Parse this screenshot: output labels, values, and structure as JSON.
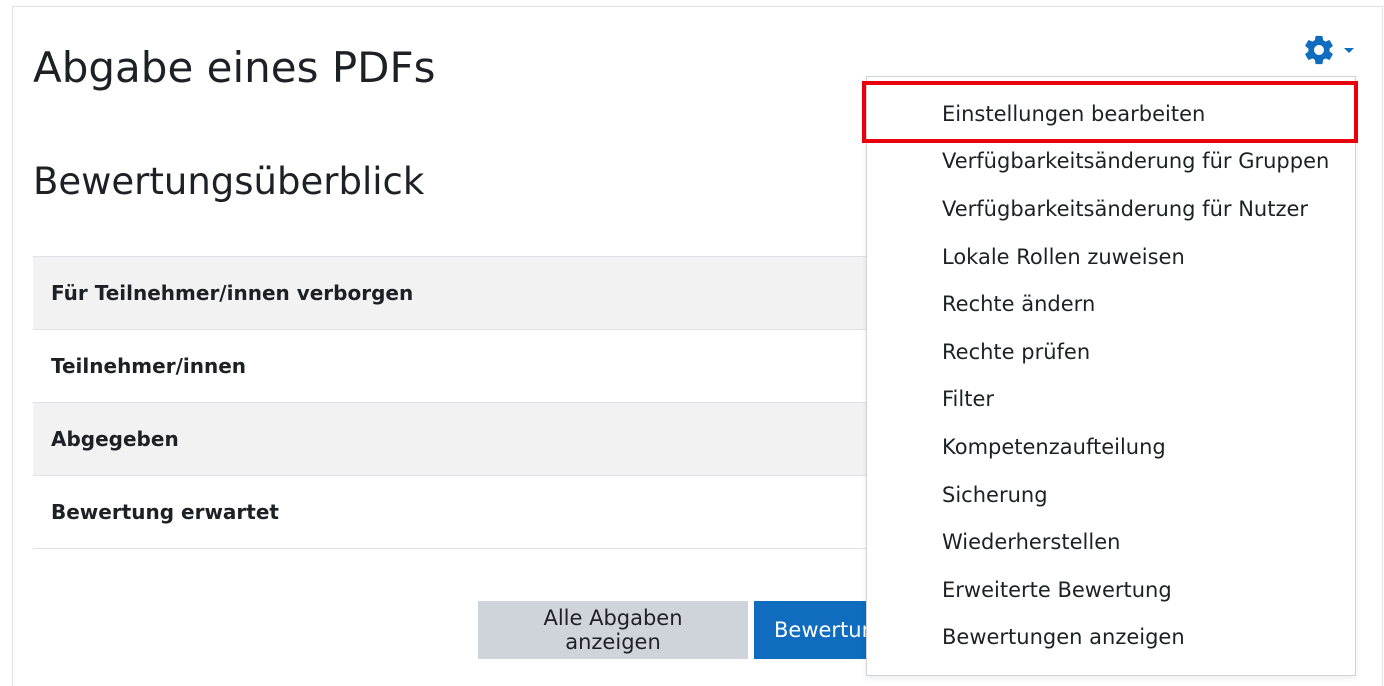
{
  "page": {
    "title": "Abgabe eines PDFs",
    "section_title": "Bewertungsüberblick"
  },
  "summary": {
    "rows": [
      {
        "label": "Für Teilnehmer/innen verborgen"
      },
      {
        "label": "Teilnehmer/innen"
      },
      {
        "label": "Abgegeben"
      },
      {
        "label": "Bewertung erwartet"
      }
    ]
  },
  "buttons": {
    "view_all": "Alle Abgaben anzeigen",
    "grade": "Bewertung"
  },
  "actions_menu": {
    "toggle_icon": "gear-icon",
    "items": [
      {
        "label": "Einstellungen bearbeiten",
        "highlighted": true
      },
      {
        "label": "Verfügbarkeitsänderung für Gruppen"
      },
      {
        "label": "Verfügbarkeitsänderung für Nutzer"
      },
      {
        "label": "Lokale Rollen zuweisen"
      },
      {
        "label": "Rechte ändern"
      },
      {
        "label": "Rechte prüfen"
      },
      {
        "label": "Filter"
      },
      {
        "label": "Kompetenzaufteilung"
      },
      {
        "label": "Sicherung"
      },
      {
        "label": "Wiederherstellen"
      },
      {
        "label": "Erweiterte Bewertung"
      },
      {
        "label": "Bewertungen anzeigen"
      }
    ]
  },
  "colors": {
    "primary": "#0f6cbf",
    "secondary": "#ced4da",
    "highlight": "#e8000b",
    "stripe": "#f2f2f2"
  }
}
